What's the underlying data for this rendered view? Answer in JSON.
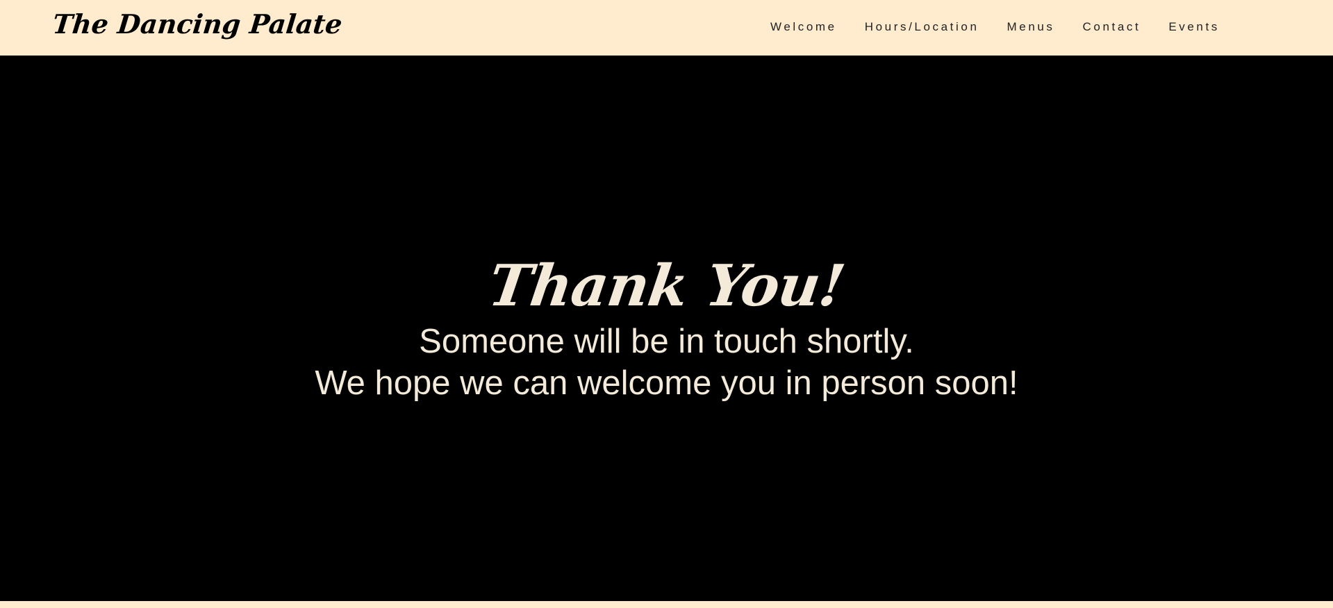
{
  "header": {
    "logo": "The Dancing Palate",
    "nav": [
      {
        "label": "Welcome"
      },
      {
        "label": "Hours/Location"
      },
      {
        "label": "Menus"
      },
      {
        "label": "Contact"
      },
      {
        "label": "Events"
      }
    ]
  },
  "hero": {
    "title": "Thank You!",
    "line1": "Someone will be in touch shortly.",
    "line2": "We hope we can welcome you in person soon!"
  },
  "colors": {
    "header_bg": "#ffebcd",
    "hero_bg": "#000000",
    "hero_text": "#f3ead9"
  }
}
